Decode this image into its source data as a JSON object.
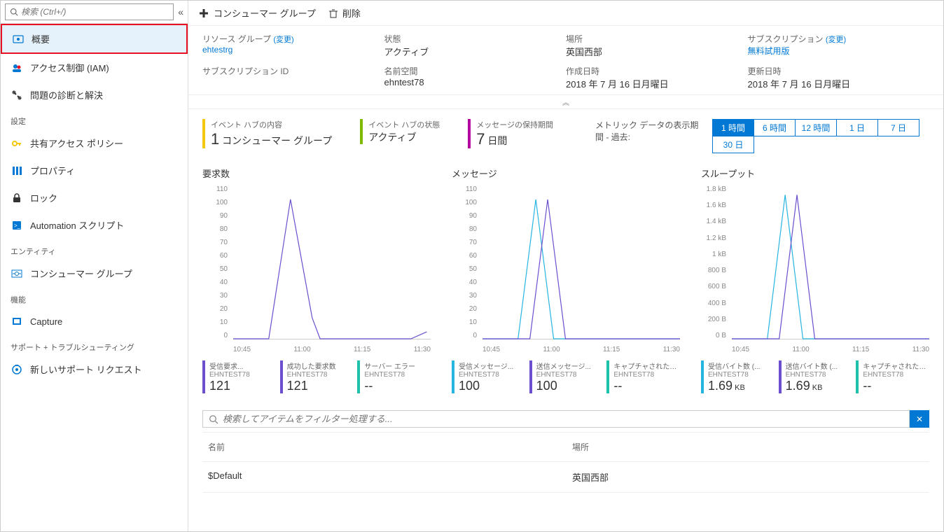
{
  "search": {
    "placeholder": "検索 (Ctrl+/)"
  },
  "nav": {
    "items": [
      {
        "label": "概要",
        "icon": "overview"
      },
      {
        "label": "アクセス制御 (IAM)",
        "icon": "iam"
      },
      {
        "label": "問題の診断と解決",
        "icon": "wrench"
      }
    ],
    "section_settings": "設定",
    "settings": [
      {
        "label": "共有アクセス ポリシー",
        "icon": "key"
      },
      {
        "label": "プロパティ",
        "icon": "props"
      },
      {
        "label": "ロック",
        "icon": "lock"
      },
      {
        "label": "Automation スクリプト",
        "icon": "script"
      }
    ],
    "section_entity": "エンティティ",
    "entity": [
      {
        "label": "コンシューマー グループ",
        "icon": "consumer"
      }
    ],
    "section_feature": "機能",
    "feature": [
      {
        "label": "Capture",
        "icon": "capture"
      }
    ],
    "section_support": "サポート + トラブルシューティング",
    "support": [
      {
        "label": "新しいサポート リクエスト",
        "icon": "support"
      }
    ]
  },
  "toolbar": {
    "consumer_group": "コンシューマー グループ",
    "delete": "削除"
  },
  "essentials": {
    "rg_label": "リソース グループ",
    "rg_change": "(変更)",
    "rg_value": "ehtestrg",
    "status_label": "状態",
    "status_value": "アクティブ",
    "location_label": "場所",
    "location_value": "英国西部",
    "sub_label": "サブスクリプション",
    "sub_change": "(変更)",
    "sub_value": "無料試用版",
    "subid_label": "サブスクリプション ID",
    "ns_label": "名前空間",
    "ns_value": "ehntest78",
    "created_label": "作成日時",
    "created_value": "2018 年 7 月 16 日月曜日",
    "updated_label": "更新日時",
    "updated_value": "2018 年 7 月 16 日月曜日"
  },
  "hubstats": {
    "contents_label": "イベント ハブの内容",
    "contents_val": "1",
    "contents_unit": "コンシューマー グループ",
    "status_label": "イベント ハブの状態",
    "status_val": "アクティブ",
    "retention_label": "メッセージの保持期間",
    "retention_val": "7",
    "retention_unit": "日間"
  },
  "period": {
    "label": "メトリック データの表示期間 - 過去:",
    "btns": [
      "1 時間",
      "6 時間",
      "12 時間",
      "1 日",
      "7 日",
      "30 日"
    ]
  },
  "charts": {
    "requests": {
      "title": "要求数",
      "yticks": [
        "110",
        "100",
        "90",
        "80",
        "70",
        "60",
        "50",
        "40",
        "30",
        "20",
        "10",
        "0"
      ],
      "xticks": [
        "10:45",
        "11:00",
        "11:15",
        "11:30"
      ],
      "colors": {
        "in": "#6b4fcf",
        "success": "#6b4fcf",
        "err": "#1ec2aa"
      },
      "legend": [
        {
          "name": "受信要求...",
          "ns": "EHNTEST78",
          "val": "121",
          "unit": "",
          "color": "#6b4fcf"
        },
        {
          "name": "成功した要求数",
          "ns": "EHNTEST78",
          "val": "121",
          "unit": "",
          "color": "#6b4fcf"
        },
        {
          "name": "サーバー エラー",
          "ns": "EHNTEST78",
          "val": "--",
          "unit": "",
          "color": "#1ec2aa"
        }
      ]
    },
    "messages": {
      "title": "メッセージ",
      "yticks": [
        "110",
        "100",
        "90",
        "80",
        "70",
        "60",
        "50",
        "40",
        "30",
        "20",
        "10",
        "0"
      ],
      "xticks": [
        "10:45",
        "11:00",
        "11:15",
        "11:30"
      ],
      "legend": [
        {
          "name": "受信メッセージ...",
          "ns": "EHNTEST78",
          "val": "100",
          "unit": "",
          "color": "#26b5e0"
        },
        {
          "name": "送信メッセージ...",
          "ns": "EHNTEST78",
          "val": "100",
          "unit": "",
          "color": "#6b4fcf"
        },
        {
          "name": "キャプチャされたメッ...",
          "ns": "EHNTEST78",
          "val": "--",
          "unit": "",
          "color": "#1ec2aa"
        }
      ]
    },
    "throughput": {
      "title": "スループット",
      "yticks": [
        "1.8 kB",
        "1.6 kB",
        "1.4 kB",
        "1.2 kB",
        "1 kB",
        "800 B",
        "600 B",
        "400 B",
        "200 B",
        "0 B"
      ],
      "xticks": [
        "10:45",
        "11:00",
        "11:15",
        "11:30"
      ],
      "legend": [
        {
          "name": "受信バイト数 (...",
          "ns": "EHNTEST78",
          "val": "1.69",
          "unit": "KB",
          "color": "#26b5e0"
        },
        {
          "name": "送信バイト数 (...",
          "ns": "EHNTEST78",
          "val": "1.69",
          "unit": "KB",
          "color": "#6b4fcf"
        },
        {
          "name": "キャプチャされたバイト数",
          "ns": "EHNTEST78",
          "val": "--",
          "unit": "",
          "color": "#1ec2aa"
        }
      ]
    }
  },
  "chart_data": [
    {
      "type": "line",
      "title": "要求数",
      "ylim": [
        0,
        110
      ],
      "xticks": [
        "10:45",
        "11:00",
        "11:15",
        "11:30"
      ],
      "series": [
        {
          "name": "受信要求",
          "color": "#6b4fcf",
          "points": [
            [
              0,
              0
            ],
            [
              0.18,
              0
            ],
            [
              0.29,
              100
            ],
            [
              0.4,
              15
            ],
            [
              0.44,
              0
            ],
            [
              0.9,
              0
            ],
            [
              0.98,
              5
            ]
          ]
        }
      ]
    },
    {
      "type": "line",
      "title": "メッセージ",
      "ylim": [
        0,
        110
      ],
      "xticks": [
        "10:45",
        "11:00",
        "11:15",
        "11:30"
      ],
      "series": [
        {
          "name": "受信メッセージ",
          "color": "#26b5e0",
          "points": [
            [
              0,
              0
            ],
            [
              0.18,
              0
            ],
            [
              0.27,
              100
            ],
            [
              0.36,
              0
            ],
            [
              1,
              0
            ]
          ]
        },
        {
          "name": "送信メッセージ",
          "color": "#6b4fcf",
          "points": [
            [
              0,
              0
            ],
            [
              0.24,
              0
            ],
            [
              0.33,
              100
            ],
            [
              0.42,
              0
            ],
            [
              1,
              0
            ]
          ]
        }
      ]
    },
    {
      "type": "line",
      "title": "スループット",
      "ylim": [
        0,
        1800
      ],
      "yunit": "B",
      "xticks": [
        "10:45",
        "11:00",
        "11:15",
        "11:30"
      ],
      "series": [
        {
          "name": "受信バイト数",
          "color": "#26b5e0",
          "points": [
            [
              0,
              0
            ],
            [
              0.18,
              0
            ],
            [
              0.27,
              1690
            ],
            [
              0.36,
              0
            ],
            [
              1,
              0
            ]
          ]
        },
        {
          "name": "送信バイト数",
          "color": "#6b4fcf",
          "points": [
            [
              0,
              0
            ],
            [
              0.24,
              0
            ],
            [
              0.33,
              1690
            ],
            [
              0.42,
              0
            ],
            [
              1,
              0
            ]
          ]
        }
      ]
    }
  ],
  "filter": {
    "placeholder": "検索してアイテムをフィルター処理する..."
  },
  "table": {
    "col_name": "名前",
    "col_loc": "場所",
    "rows": [
      {
        "name": "$Default",
        "loc": "英国西部"
      }
    ]
  }
}
